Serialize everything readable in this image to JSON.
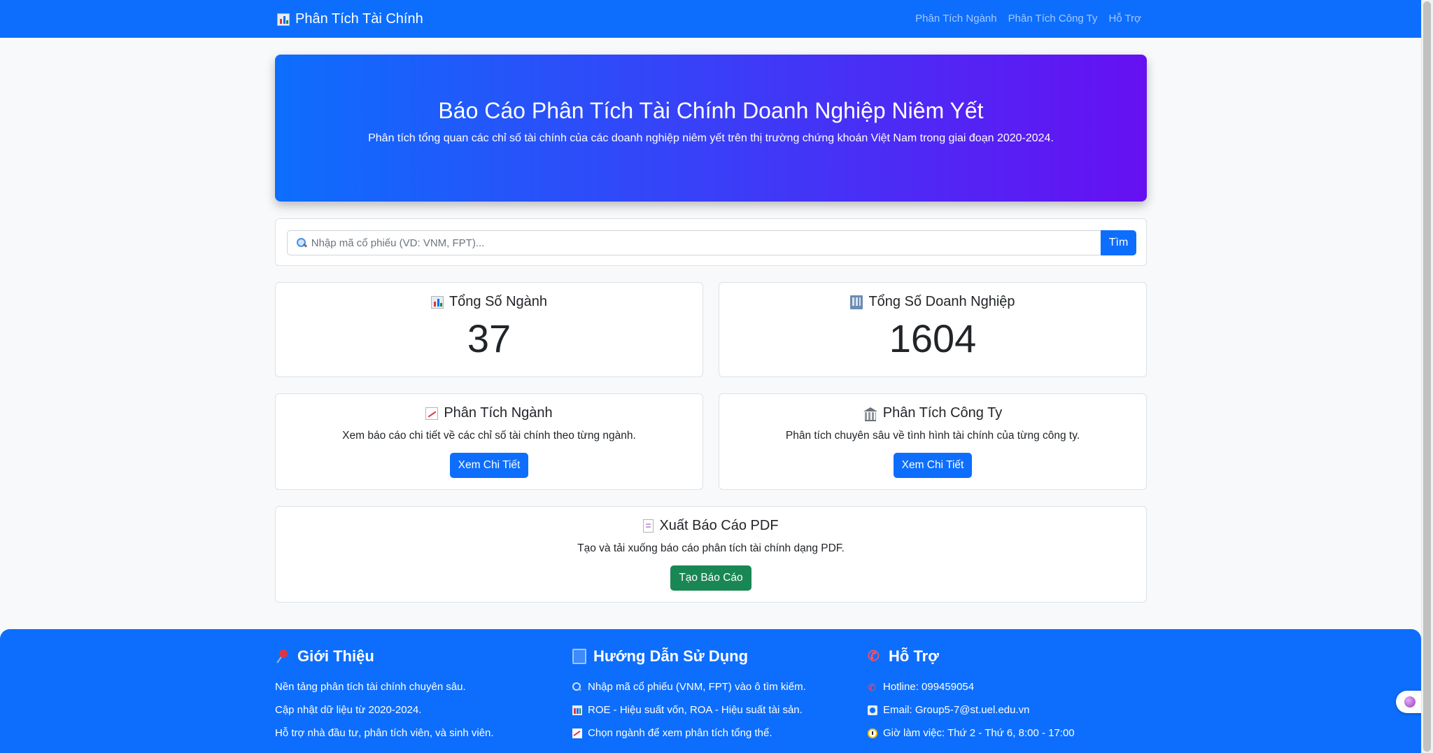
{
  "navbar": {
    "brand": "Phân Tích Tài Chính",
    "links": [
      "Phân Tích Ngành",
      "Phân Tích Công Ty",
      "Hỗ Trợ"
    ]
  },
  "hero": {
    "title": "Báo Cáo Phân Tích Tài Chính Doanh Nghiệp Niêm Yết",
    "subtitle": "Phân tích tổng quan các chỉ số tài chính của các doanh nghiệp niêm yết trên thị trường chứng khoán Việt Nam trong giai đoạn 2020-2024."
  },
  "search": {
    "placeholder": "Nhập mã cổ phiếu (VD: VNM, FPT)...",
    "button": "Tìm"
  },
  "stats": [
    {
      "title": "Tổng Số Ngành",
      "value": "37",
      "icon": "bar-chart-icon"
    },
    {
      "title": "Tổng Số Doanh Nghiệp",
      "value": "1604",
      "icon": "office-building-icon"
    }
  ],
  "features": [
    {
      "title": "Phân Tích Ngành",
      "text": "Xem báo cáo chi tiết về các chỉ số tài chính theo từng ngành.",
      "button": "Xem Chi Tiết",
      "icon": "chart-increasing-icon"
    },
    {
      "title": "Phân Tích Công Ty",
      "text": "Phân tích chuyên sâu về tình hình tài chính của từng công ty.",
      "button": "Xem Chi Tiết",
      "icon": "bank-icon"
    }
  ],
  "report": {
    "title": "Xuất Báo Cáo PDF",
    "text": "Tạo và tải xuống báo cáo phân tích tài chính dạng PDF.",
    "button": "Tạo Báo Cáo",
    "icon": "document-icon"
  },
  "footer": {
    "about": {
      "title": "Giới Thiệu",
      "items": [
        "Nền tảng phân tích tài chính chuyên sâu.",
        "Cập nhật dữ liệu từ 2020-2024.",
        "Hỗ trợ nhà đầu tư, phân tích viên, và sinh viên."
      ]
    },
    "guide": {
      "title": "Hướng Dẫn Sử Dụng",
      "items": [
        "Nhập mã cổ phiếu (VNM, FPT) vào ô tìm kiếm.",
        "ROE - Hiệu suất vốn, ROA - Hiệu suất tài sản.",
        "Chọn ngành để xem phân tích tổng thể."
      ]
    },
    "support": {
      "title": "Hỗ Trợ",
      "items": [
        "Hotline: 099459054",
        "Email: Group5-7@st.uel.edu.vn",
        "Giờ làm việc: Thứ 2 - Thứ 6, 8:00 - 17:00"
      ]
    }
  },
  "colors": {
    "primary": "#0d6efd",
    "success": "#198754",
    "gradient_end": "#6610f2"
  }
}
